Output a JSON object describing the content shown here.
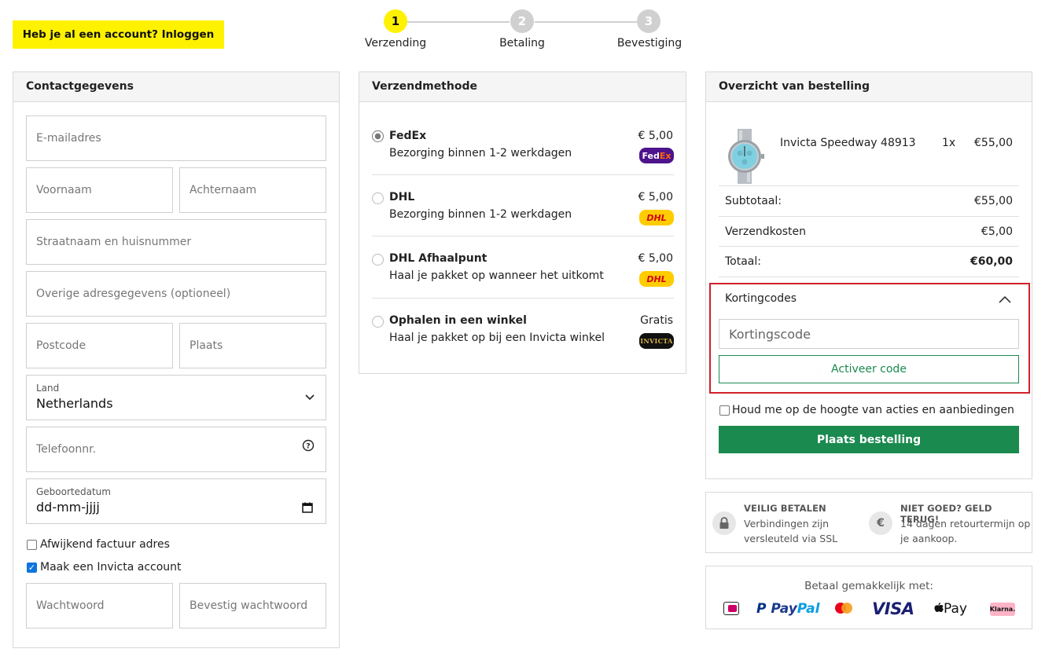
{
  "header": {
    "login_label": "Heb je al een account? Inloggen",
    "steps": [
      {
        "number": "1",
        "label": "Verzending",
        "active": true
      },
      {
        "number": "2",
        "label": "Betaling",
        "active": false
      },
      {
        "number": "3",
        "label": "Bevestiging",
        "active": false
      }
    ]
  },
  "contact": {
    "title": "Contactgegevens",
    "email_placeholder": "E-mailadres",
    "firstname_placeholder": "Voornaam",
    "lastname_placeholder": "Achternaam",
    "street_placeholder": "Straatnaam en huisnummer",
    "extra_address_placeholder": "Overige adresgegevens (optioneel)",
    "postcode_placeholder": "Postcode",
    "city_placeholder": "Plaats",
    "country_label": "Land",
    "country_value": "Netherlands",
    "phone_placeholder": "Telefoonnr.",
    "birthdate_label": "Geboortedatum",
    "birthdate_value": "dd-mm-jjjj",
    "different_invoice_label": "Afwijkend factuur adres",
    "different_invoice_checked": false,
    "create_account_label": "Maak een Invicta account",
    "create_account_checked": true,
    "password_placeholder": "Wachtwoord",
    "confirm_password_placeholder": "Bevestig wachtwoord"
  },
  "shipping": {
    "title": "Verzendmethode",
    "options": [
      {
        "name": "FedEx",
        "description": "Bezorging binnen 1-2 werkdagen",
        "price": "€ 5,00",
        "selected": true,
        "logo": "FedEx"
      },
      {
        "name": "DHL",
        "description": "Bezorging binnen 1-2 werkdagen",
        "price": "€ 5,00",
        "selected": false,
        "logo": "DHL"
      },
      {
        "name": "DHL Afhaalpunt",
        "description": "Haal je pakket op wanneer het uitkomt",
        "price": "€ 5,00",
        "selected": false,
        "logo": "DHL"
      },
      {
        "name": "Ophalen in een winkel",
        "description": "Haal je pakket op bij een Invicta winkel",
        "price": "Gratis",
        "selected": false,
        "logo": "INVICTA"
      }
    ]
  },
  "summary": {
    "title": "Overzicht van bestelling",
    "product": {
      "name": "Invicta Speedway 48913",
      "qty": "1x",
      "price": "€55,00"
    },
    "subtotal_label": "Subtotaal:",
    "subtotal_value": "€55,00",
    "shipping_label": "Verzendkosten",
    "shipping_value": "€5,00",
    "total_label": "Totaal:",
    "total_value": "€60,00",
    "discount_title": "Kortingcodes",
    "discount_placeholder": "Kortingscode",
    "discount_button": "Activeer code",
    "newsletter_label": "Houd me op de hoogte van acties en aanbiedingen",
    "newsletter_checked": false,
    "place_order_label": "Plaats bestelling"
  },
  "trust": {
    "secure_title": "VEILIG BETALEN",
    "secure_text_1": "Verbindingen zijn",
    "secure_text_2": "versleuteld via SSL",
    "refund_title": "NIET GOED? GELD TERUG!",
    "refund_text_1": "14 dagen retourtermijn op",
    "refund_text_2": "je aankoop."
  },
  "payment": {
    "title": "Betaal gemakkelijk met:",
    "methods": [
      "iDEAL",
      "PayPal",
      "Mastercard",
      "VISA",
      "Apple Pay",
      "Klarna."
    ]
  },
  "colors": {
    "brand_yellow": "#fff200",
    "action_green": "#1a8a4f",
    "highlight_red": "#d0202a"
  }
}
